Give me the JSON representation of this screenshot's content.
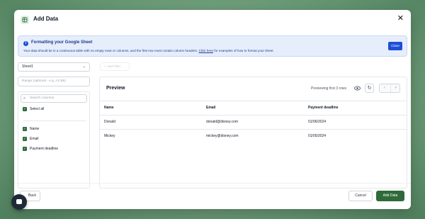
{
  "modal": {
    "title": "Add Data",
    "close_symbol": "✕"
  },
  "banner": {
    "title": "Formatting your Google Sheet",
    "text_before": "Your data should be in a continuous table with no empty rows or columns, and the first row must contain column headers.",
    "link_text": "Click here",
    "text_after": "for examples of how to format your sheet.",
    "close_label": "Close"
  },
  "left_panel": {
    "sheet_select": "Sheet1",
    "range_placeholder": "Range (optional - e.g. A1:B5)",
    "search_placeholder": "Search columns",
    "select_all_label": "Select all",
    "columns": [
      {
        "label": "Name",
        "checked": true
      },
      {
        "label": "Email",
        "checked": true
      },
      {
        "label": "Payment deadline",
        "checked": true
      }
    ]
  },
  "filter": {
    "add_filter_label": "+ Add Filter"
  },
  "preview": {
    "title": "Preview",
    "count_text": "Previewing first 3 rows",
    "headers": [
      "Name",
      "Email",
      "Payment deadline"
    ],
    "rows": [
      [
        "Donald",
        "donald@disney.com",
        "01/06/2024"
      ],
      [
        "Mickey",
        "mickey@disney.com",
        "01/05/2024"
      ]
    ]
  },
  "footer": {
    "back_label": "Back",
    "cancel_label": "Cancel",
    "add_label": "Add Data"
  },
  "icons": {
    "app": "sheet-icon",
    "info": "info-icon",
    "eye": "eye-icon",
    "refresh": "refresh-icon",
    "chat": "chat-icon"
  },
  "colors": {
    "primary_green": "#2f6b3a",
    "banner_blue": "#1d4ed8",
    "banner_bg": "#e6eefc"
  }
}
